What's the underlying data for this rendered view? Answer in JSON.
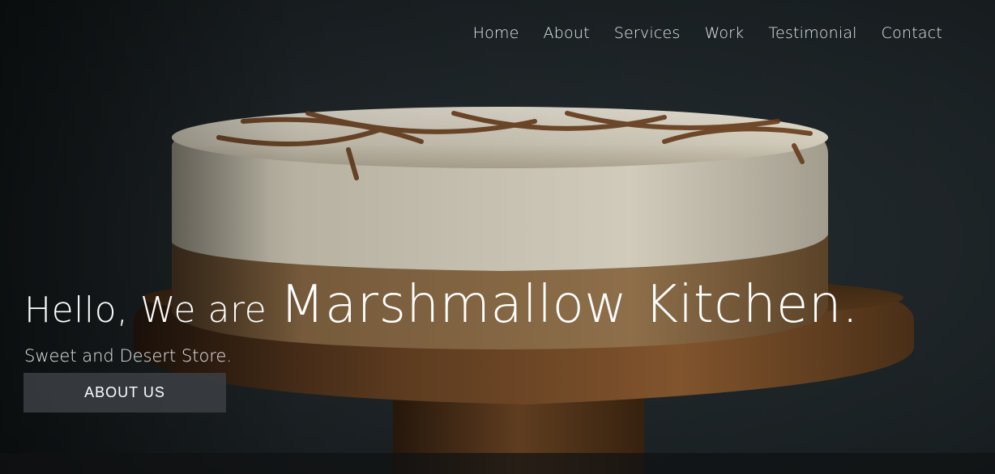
{
  "nav": {
    "items": [
      {
        "label": "Home"
      },
      {
        "label": "About"
      },
      {
        "label": "Services"
      },
      {
        "label": "Work"
      },
      {
        "label": "Testimonial"
      },
      {
        "label": "Contact"
      }
    ]
  },
  "hero": {
    "greeting": "Hello, We are",
    "brand": "Marshmallow Kitchen.",
    "tagline": "Sweet and Desert Store.",
    "cta_label": "ABOUT US"
  },
  "colors": {
    "background": "#1d2427",
    "text": "#ffffff",
    "button_bg": "#3c4044"
  }
}
